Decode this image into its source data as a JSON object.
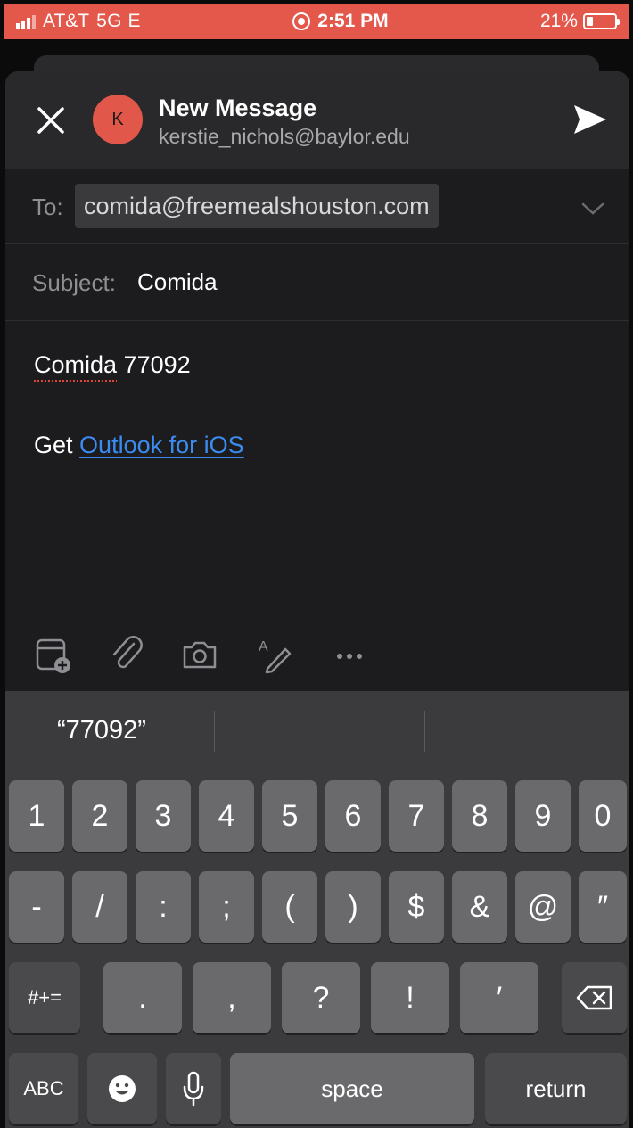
{
  "status_bar": {
    "carrier": "AT&T",
    "network": "5G E",
    "time": "2:51 PM",
    "battery": "21%"
  },
  "header": {
    "avatar_initial": "K",
    "title": "New Message",
    "account": "kerstie_nichols@baylor.edu"
  },
  "compose": {
    "to_label": "To:",
    "to_value": "comida@freemealshouston.com",
    "subject_label": "Subject:",
    "subject_value": "Comida",
    "body_word1": "Comida",
    "body_word2": "77092",
    "signature_prefix": "Get",
    "signature_link": "Outlook for iOS"
  },
  "toolbar": {
    "icons": [
      "calendar-add-icon",
      "attachment-icon",
      "camera-icon",
      "draw-icon",
      "more-icon"
    ]
  },
  "keyboard": {
    "suggestion": "“77092”",
    "row1": [
      "1",
      "2",
      "3",
      "4",
      "5",
      "6",
      "7",
      "8",
      "9",
      "0"
    ],
    "row2": [
      "-",
      "/",
      ":",
      ";",
      "(",
      ")",
      "$",
      "&",
      "@",
      "″"
    ],
    "row3_left": "#+=",
    "row3": [
      ".",
      ",",
      "?",
      "!",
      "′"
    ],
    "row4": {
      "abc": "ABC",
      "space": "space",
      "return": "return"
    }
  },
  "colors": {
    "status_bar": "#e4574b",
    "avatar": "#e1574a",
    "link": "#3b8cf0",
    "keyboard_bg": "#3b3b3d",
    "key": "#6a6a6c"
  }
}
